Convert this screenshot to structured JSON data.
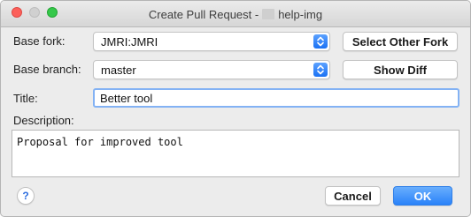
{
  "window": {
    "title_prefix": "Create Pull Request - ",
    "title_suffix": "help-img"
  },
  "form": {
    "base_fork": {
      "label": "Base fork:",
      "value": "JMRI:JMRI"
    },
    "base_branch": {
      "label": "Base branch:",
      "value": "master"
    },
    "title": {
      "label": "Title:",
      "value": "Better tool"
    },
    "description": {
      "label": "Description:",
      "value": "Proposal for improved tool"
    }
  },
  "buttons": {
    "select_other_fork": "Select Other Fork",
    "show_diff": "Show Diff",
    "cancel": "Cancel",
    "ok": "OK",
    "help": "?"
  },
  "colors": {
    "accent": "#2a82f9",
    "focus_ring": "#83b2f4"
  }
}
